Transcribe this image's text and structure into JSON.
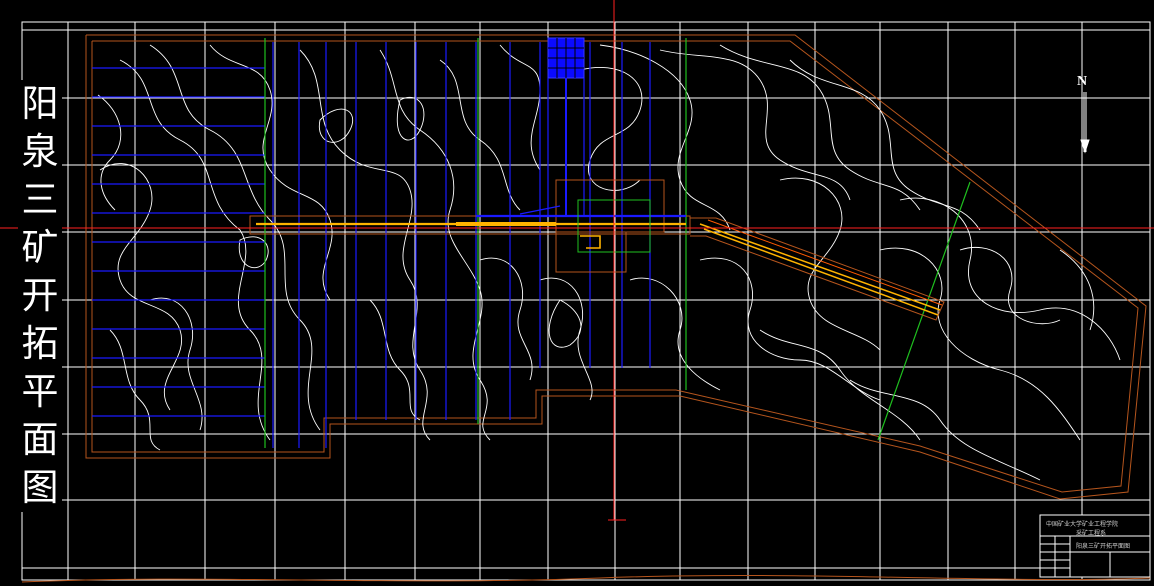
{
  "title_vertical": "阳泉三矿开拓平面图",
  "north_label": "N",
  "title_block": {
    "line1": "中国矿业大学矿业工程学院",
    "line2": "采矿工程系",
    "drawing_name": "阳泉三矿开拓平面图"
  },
  "colors": {
    "background": "#000000",
    "grid": "#ffffff",
    "contour": "#ffffff",
    "boundary": "#b5551d",
    "panel_lines": "#1a1aff",
    "green_lines": "#1fbf1f",
    "main_roadway": "#ffb300",
    "red_axis": "#ff2020"
  }
}
